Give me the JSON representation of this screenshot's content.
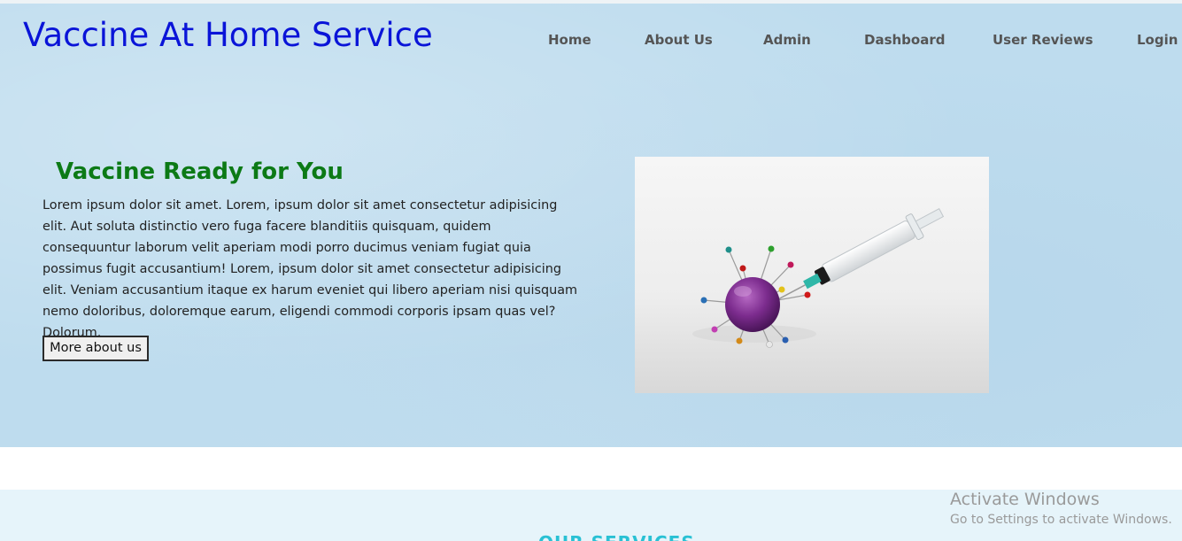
{
  "header": {
    "brand": "Vaccine At Home Service",
    "nav": [
      "Home",
      "About Us",
      "Admin",
      "Dashboard",
      "User Reviews",
      "Login"
    ]
  },
  "hero": {
    "title": "Vaccine Ready for You",
    "text": "Lorem ipsum dolor sit amet. Lorem, ipsum dolor sit amet consectetur adipisicing elit. Aut soluta distinctio vero fuga facere blanditiis quisquam, quidem consequuntur laborum velit aperiam modi porro ducimus veniam fugiat quia possimus fugit accusantium! Lorem, ipsum dolor sit amet consectetur adipisicing elit. Veniam accusantium itaque ex harum eveniet qui libero aperiam nisi quisquam nemo doloribus, doloremque earum, eligendi commodi corporis ipsam quas vel? Dolorum.",
    "button": "More about us",
    "image": "virus-and-syringe-image"
  },
  "services": {
    "title": "OUR SERVICES"
  },
  "watermark": {
    "title": "Activate Windows",
    "subtitle": "Go to Settings to activate Windows."
  },
  "colors": {
    "brand": "#0a14d8",
    "hero_title": "#0c7a16",
    "hero_bg": "#bedcee",
    "services_title": "#29c1d4"
  }
}
